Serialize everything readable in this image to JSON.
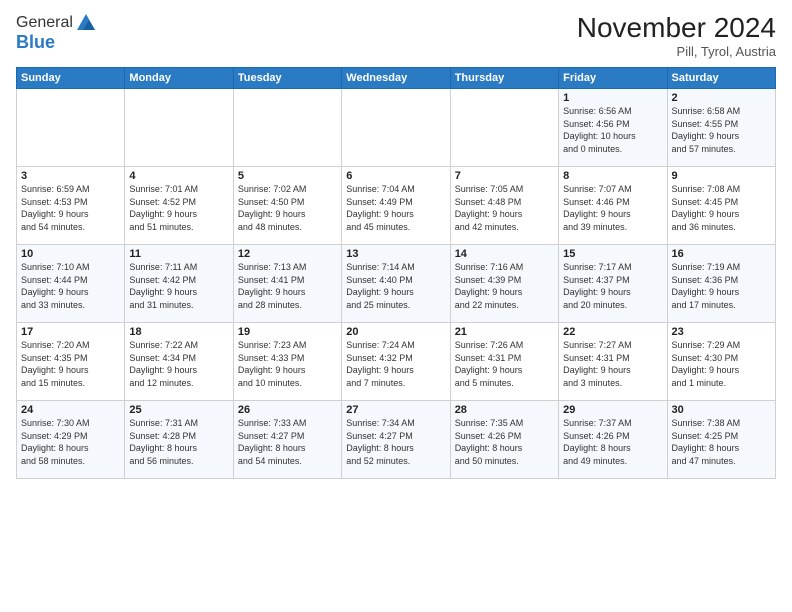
{
  "logo": {
    "line1": "General",
    "line2": "Blue"
  },
  "title": "November 2024",
  "subtitle": "Pill, Tyrol, Austria",
  "headers": [
    "Sunday",
    "Monday",
    "Tuesday",
    "Wednesday",
    "Thursday",
    "Friday",
    "Saturday"
  ],
  "weeks": [
    [
      {
        "num": "",
        "detail": ""
      },
      {
        "num": "",
        "detail": ""
      },
      {
        "num": "",
        "detail": ""
      },
      {
        "num": "",
        "detail": ""
      },
      {
        "num": "",
        "detail": ""
      },
      {
        "num": "1",
        "detail": "Sunrise: 6:56 AM\nSunset: 4:56 PM\nDaylight: 10 hours\nand 0 minutes."
      },
      {
        "num": "2",
        "detail": "Sunrise: 6:58 AM\nSunset: 4:55 PM\nDaylight: 9 hours\nand 57 minutes."
      }
    ],
    [
      {
        "num": "3",
        "detail": "Sunrise: 6:59 AM\nSunset: 4:53 PM\nDaylight: 9 hours\nand 54 minutes."
      },
      {
        "num": "4",
        "detail": "Sunrise: 7:01 AM\nSunset: 4:52 PM\nDaylight: 9 hours\nand 51 minutes."
      },
      {
        "num": "5",
        "detail": "Sunrise: 7:02 AM\nSunset: 4:50 PM\nDaylight: 9 hours\nand 48 minutes."
      },
      {
        "num": "6",
        "detail": "Sunrise: 7:04 AM\nSunset: 4:49 PM\nDaylight: 9 hours\nand 45 minutes."
      },
      {
        "num": "7",
        "detail": "Sunrise: 7:05 AM\nSunset: 4:48 PM\nDaylight: 9 hours\nand 42 minutes."
      },
      {
        "num": "8",
        "detail": "Sunrise: 7:07 AM\nSunset: 4:46 PM\nDaylight: 9 hours\nand 39 minutes."
      },
      {
        "num": "9",
        "detail": "Sunrise: 7:08 AM\nSunset: 4:45 PM\nDaylight: 9 hours\nand 36 minutes."
      }
    ],
    [
      {
        "num": "10",
        "detail": "Sunrise: 7:10 AM\nSunset: 4:44 PM\nDaylight: 9 hours\nand 33 minutes."
      },
      {
        "num": "11",
        "detail": "Sunrise: 7:11 AM\nSunset: 4:42 PM\nDaylight: 9 hours\nand 31 minutes."
      },
      {
        "num": "12",
        "detail": "Sunrise: 7:13 AM\nSunset: 4:41 PM\nDaylight: 9 hours\nand 28 minutes."
      },
      {
        "num": "13",
        "detail": "Sunrise: 7:14 AM\nSunset: 4:40 PM\nDaylight: 9 hours\nand 25 minutes."
      },
      {
        "num": "14",
        "detail": "Sunrise: 7:16 AM\nSunset: 4:39 PM\nDaylight: 9 hours\nand 22 minutes."
      },
      {
        "num": "15",
        "detail": "Sunrise: 7:17 AM\nSunset: 4:37 PM\nDaylight: 9 hours\nand 20 minutes."
      },
      {
        "num": "16",
        "detail": "Sunrise: 7:19 AM\nSunset: 4:36 PM\nDaylight: 9 hours\nand 17 minutes."
      }
    ],
    [
      {
        "num": "17",
        "detail": "Sunrise: 7:20 AM\nSunset: 4:35 PM\nDaylight: 9 hours\nand 15 minutes."
      },
      {
        "num": "18",
        "detail": "Sunrise: 7:22 AM\nSunset: 4:34 PM\nDaylight: 9 hours\nand 12 minutes."
      },
      {
        "num": "19",
        "detail": "Sunrise: 7:23 AM\nSunset: 4:33 PM\nDaylight: 9 hours\nand 10 minutes."
      },
      {
        "num": "20",
        "detail": "Sunrise: 7:24 AM\nSunset: 4:32 PM\nDaylight: 9 hours\nand 7 minutes."
      },
      {
        "num": "21",
        "detail": "Sunrise: 7:26 AM\nSunset: 4:31 PM\nDaylight: 9 hours\nand 5 minutes."
      },
      {
        "num": "22",
        "detail": "Sunrise: 7:27 AM\nSunset: 4:31 PM\nDaylight: 9 hours\nand 3 minutes."
      },
      {
        "num": "23",
        "detail": "Sunrise: 7:29 AM\nSunset: 4:30 PM\nDaylight: 9 hours\nand 1 minute."
      }
    ],
    [
      {
        "num": "24",
        "detail": "Sunrise: 7:30 AM\nSunset: 4:29 PM\nDaylight: 8 hours\nand 58 minutes."
      },
      {
        "num": "25",
        "detail": "Sunrise: 7:31 AM\nSunset: 4:28 PM\nDaylight: 8 hours\nand 56 minutes."
      },
      {
        "num": "26",
        "detail": "Sunrise: 7:33 AM\nSunset: 4:27 PM\nDaylight: 8 hours\nand 54 minutes."
      },
      {
        "num": "27",
        "detail": "Sunrise: 7:34 AM\nSunset: 4:27 PM\nDaylight: 8 hours\nand 52 minutes."
      },
      {
        "num": "28",
        "detail": "Sunrise: 7:35 AM\nSunset: 4:26 PM\nDaylight: 8 hours\nand 50 minutes."
      },
      {
        "num": "29",
        "detail": "Sunrise: 7:37 AM\nSunset: 4:26 PM\nDaylight: 8 hours\nand 49 minutes."
      },
      {
        "num": "30",
        "detail": "Sunrise: 7:38 AM\nSunset: 4:25 PM\nDaylight: 8 hours\nand 47 minutes."
      }
    ]
  ]
}
